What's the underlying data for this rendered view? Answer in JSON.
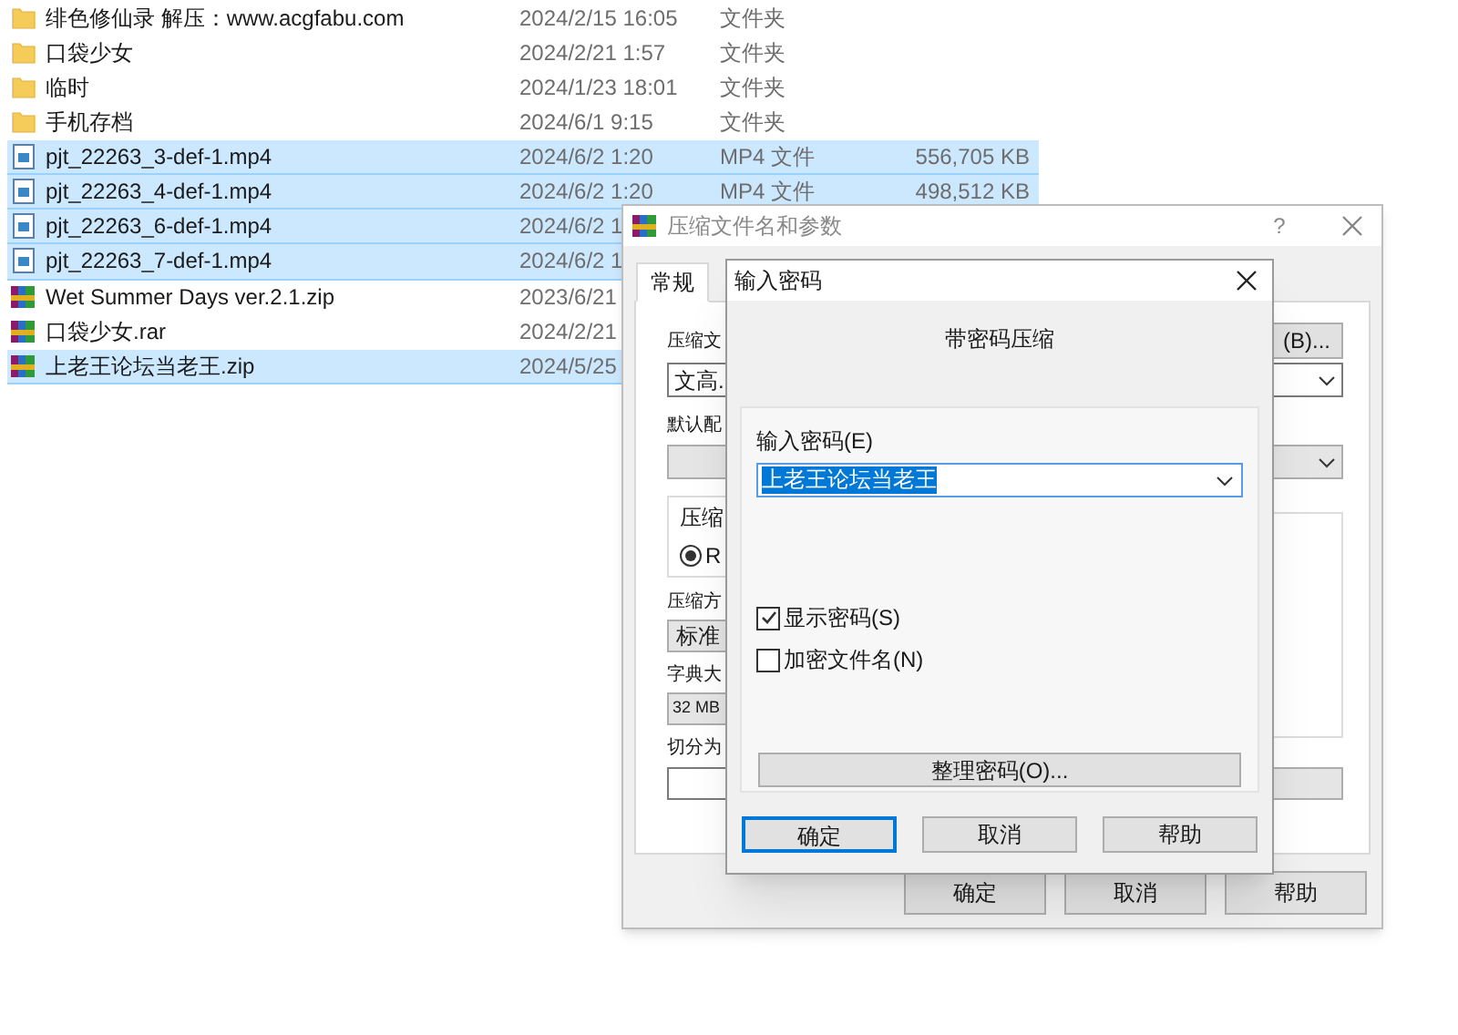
{
  "file_list": {
    "rows": [
      {
        "kind": "folder",
        "name": "绯色修仙录  解压：www.acgfabu.com",
        "date": "2024/2/15 16:05",
        "type": "文件夹",
        "selected": false
      },
      {
        "kind": "folder",
        "name": "口袋少女",
        "date": "2024/2/21 1:57",
        "type": "文件夹",
        "selected": false
      },
      {
        "kind": "folder",
        "name": "临时",
        "date": "2024/1/23 18:01",
        "type": "文件夹",
        "selected": false
      },
      {
        "kind": "folder",
        "name": "手机存档",
        "date": "2024/6/1 9:15",
        "type": "文件夹",
        "selected": false
      },
      {
        "kind": "video",
        "name": "pjt_22263_3-def-1.mp4",
        "date": "2024/6/2 1:20",
        "type": "MP4 文件",
        "size": "556,705 KB",
        "selected": true
      },
      {
        "kind": "video",
        "name": "pjt_22263_4-def-1.mp4",
        "date": "2024/6/2 1:20",
        "type": "MP4 文件",
        "size": "498,512 KB",
        "selected": true
      },
      {
        "kind": "video",
        "name": "pjt_22263_6-def-1.mp4",
        "date": "2024/6/2 1",
        "selected": true
      },
      {
        "kind": "video",
        "name": "pjt_22263_7-def-1.mp4",
        "date": "2024/6/2 1",
        "selected": true
      },
      {
        "kind": "archive",
        "name": "Wet Summer Days ver.2.1.zip",
        "date": "2023/6/21",
        "selected": false
      },
      {
        "kind": "archive",
        "name": "口袋少女.rar",
        "date": "2024/2/21",
        "selected": false
      },
      {
        "kind": "archive",
        "name": "上老王论坛当老王.zip",
        "date": "2024/5/25",
        "selected": true
      }
    ]
  },
  "archive_dialog": {
    "title": "压缩文件名和参数",
    "help": "?",
    "tabs": [
      {
        "label": "常规",
        "selected": true
      }
    ],
    "archive_name_label": "压缩文",
    "browse_button": "(B)...",
    "archive_name_value": "文高.",
    "profile_label": "默认配",
    "format_group_label": "压缩",
    "format_radio": {
      "label": "R",
      "selected": true
    },
    "method_label": "压缩方",
    "method_value": "标准",
    "dictionary_label": "字典大",
    "dictionary_value": "32 MB",
    "split_label": "切分为",
    "buttons": [
      "确定",
      "取消",
      "帮助"
    ]
  },
  "password_dialog": {
    "title": "输入密码",
    "heading": "带密码压缩",
    "password_label": "输入密码(E)",
    "password_value": "上老王论坛当老王",
    "options": [
      {
        "label": "显示密码(S)",
        "checked": true
      },
      {
        "label": "加密文件名(N)",
        "checked": false
      }
    ],
    "organize_button": "整理密码(O)...",
    "buttons": [
      {
        "label": "确定",
        "focused": true
      },
      {
        "label": "取消",
        "focused": false
      },
      {
        "label": "帮助",
        "focused": false
      }
    ]
  }
}
